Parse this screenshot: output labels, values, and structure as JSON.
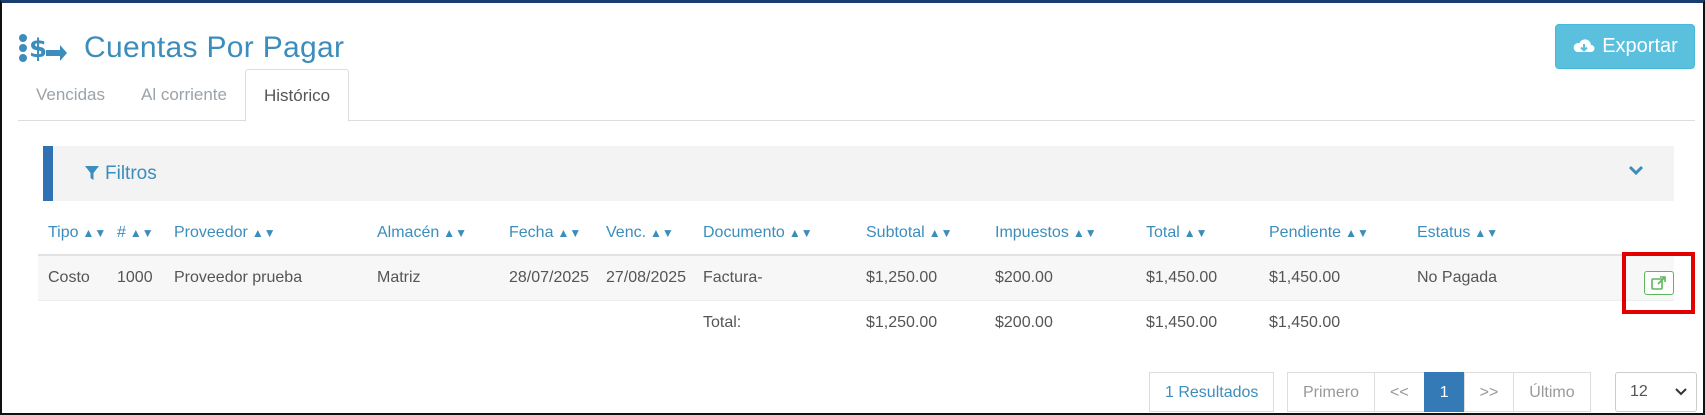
{
  "page": {
    "title": "Cuentas Por Pagar",
    "logo_icon": "money-transfer-icon",
    "export_label": "Exportar",
    "export_icon": "cloud-download-icon"
  },
  "tabs": [
    {
      "label": "Vencidas",
      "active": false
    },
    {
      "label": "Al corriente",
      "active": false
    },
    {
      "label": "Histórico",
      "active": true
    }
  ],
  "filters": {
    "label": "Filtros",
    "icon": "filter-icon",
    "toggle_icon": "chevron-down-icon"
  },
  "table": {
    "columns": [
      "Tipo",
      "#",
      "Proveedor",
      "Almacén",
      "Fecha",
      "Venc.",
      "Documento",
      "Subtotal",
      "Impuestos",
      "Total",
      "Pendiente",
      "Estatus"
    ],
    "rows": [
      {
        "tipo": "Costo",
        "num": "1000",
        "proveedor": "Proveedor prueba",
        "almacen": "Matriz",
        "fecha": "28/07/2025",
        "venc": "27/08/2025",
        "documento": "Factura-",
        "subtotal": "$1,250.00",
        "impuestos": "$200.00",
        "total": "$1,450.00",
        "pendiente": "$1,450.00",
        "estatus": "No Pagada",
        "action_icon": "external-link-icon"
      }
    ],
    "totals": {
      "label": "Total:",
      "subtotal": "$1,250.00",
      "impuestos": "$200.00",
      "total": "$1,450.00",
      "pendiente": "$1,450.00"
    }
  },
  "pagination": {
    "results": "1 Resultados",
    "first": "Primero",
    "prev": "<<",
    "current": "1",
    "next": ">>",
    "last": "Último",
    "page_size": "12"
  },
  "colors": {
    "accent": "#3c8dbc",
    "export_button": "#5bc0de",
    "filter_bar": "#3071b3",
    "highlight_box": "#e30000",
    "action_green": "#5cb85c"
  }
}
